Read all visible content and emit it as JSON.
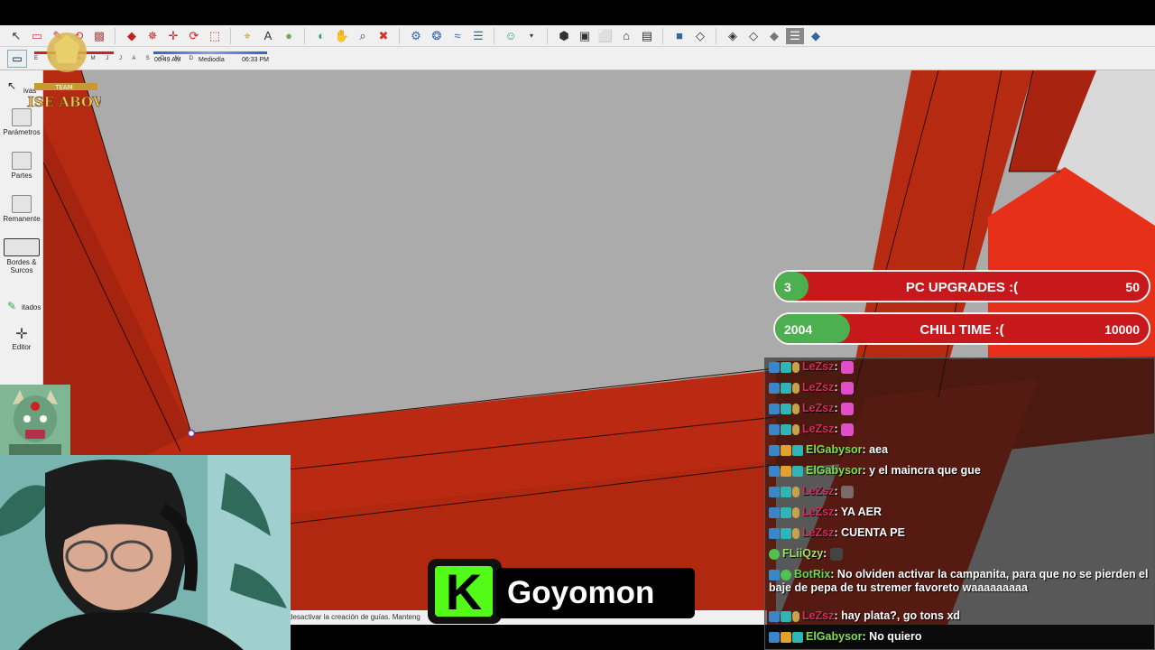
{
  "toolbar": {
    "icons": [
      "select-icon",
      "eraser-icon",
      "paint-icon",
      "lasso-icon",
      "rectangle-icon",
      "push-pull-icon",
      "follow-me-icon",
      "move-icon",
      "rotate-icon",
      "scale-icon",
      "tape-measure-icon",
      "text-icon",
      "paint-bucket-icon",
      "orbit-icon",
      "walk-icon",
      "zoom-icon",
      "zoom-extents-icon",
      "components-icon",
      "solid-tools-icon",
      "sandbox-icon",
      "layers-icon",
      "user-icon",
      "iso-view-icon",
      "top-view-icon",
      "front-view-icon",
      "home-view-icon",
      "back-view-icon",
      "shaded-icon",
      "wireframe-icon",
      "hidden-line-icon",
      "shaded-texture-icon",
      "monochrome-icon",
      "xray-icon",
      "style-icon"
    ]
  },
  "shadow_settings": {
    "months": "E F M A M J J A S O N D",
    "time_start": "06:49 AM",
    "time_mid": "Mediodía",
    "time_end": "06:33 PM"
  },
  "sidebar": {
    "items": [
      {
        "label": "ivas",
        "icon": "arrow-cursor-icon"
      },
      {
        "label": "Parámetros",
        "icon": "sliders-icon"
      },
      {
        "label": "Partes",
        "icon": "layers-icon"
      },
      {
        "label": "Remanente",
        "icon": "copy-icon"
      },
      {
        "label": "Bordes & Surcos",
        "icon": "edge-icon"
      },
      {
        "label": "itados",
        "icon": "pencil-icon"
      },
      {
        "label": "Editor",
        "icon": "move-arrows-icon"
      }
    ]
  },
  "logo": {
    "text": "TEAM RISE ABOVE"
  },
  "statusbar": {
    "text": "desactivar la creación de guías. Manteng"
  },
  "goals": [
    {
      "current": "3",
      "title": "PC UPGRADES :(",
      "target": "50",
      "progress": 0.06
    },
    {
      "current": "2004",
      "title": "CHILI TIME :(",
      "target": "10000",
      "progress": 0.2
    }
  ],
  "chat": {
    "messages": [
      {
        "user": "LeZsz",
        "color": "#d0305a",
        "text": "",
        "emote": "pink-emote"
      },
      {
        "user": "LeZsz",
        "color": "#d0305a",
        "text": "",
        "emote": "pink-emote"
      },
      {
        "user": "LeZsz",
        "color": "#d0305a",
        "text": "",
        "emote": "pink-emote"
      },
      {
        "user": "LeZsz",
        "color": "#d0305a",
        "text": "",
        "emote": "pink-emote"
      },
      {
        "user": "ElGabysor",
        "color": "#7fe04a",
        "text": "aea",
        "emote": ""
      },
      {
        "user": "ElGabysor",
        "color": "#7fe04a",
        "text": "y el maincra que gue",
        "emote": ""
      },
      {
        "user": "LeZsz",
        "color": "#d0305a",
        "text": "",
        "emote": "cat-emote"
      },
      {
        "user": "LeZsz",
        "color": "#d0305a",
        "text": "YA AER",
        "emote": ""
      },
      {
        "user": "LeZsz",
        "color": "#d0305a",
        "text": "CUENTA PE",
        "emote": ""
      },
      {
        "user": "FLiiQzy",
        "color": "#9fe06a",
        "text": "",
        "emote": "person-emote"
      },
      {
        "user": "BotRix",
        "color": "#5fdc4a",
        "text": "No olviden activar la campanita, para que no se pierden el baje de pepa de tu stremer favoreto waaaaaaaaa",
        "emote": ""
      },
      {
        "user": "LeZsz",
        "color": "#d0305a",
        "text": "hay plata?, go tons xd",
        "emote": ""
      },
      {
        "user": "ElGabysor",
        "color": "#7fe04a",
        "text": "No quiero",
        "emote": ""
      }
    ]
  },
  "kick": {
    "logo": "K",
    "name": "Goyomon",
    "brand_color": "#53fc18"
  }
}
